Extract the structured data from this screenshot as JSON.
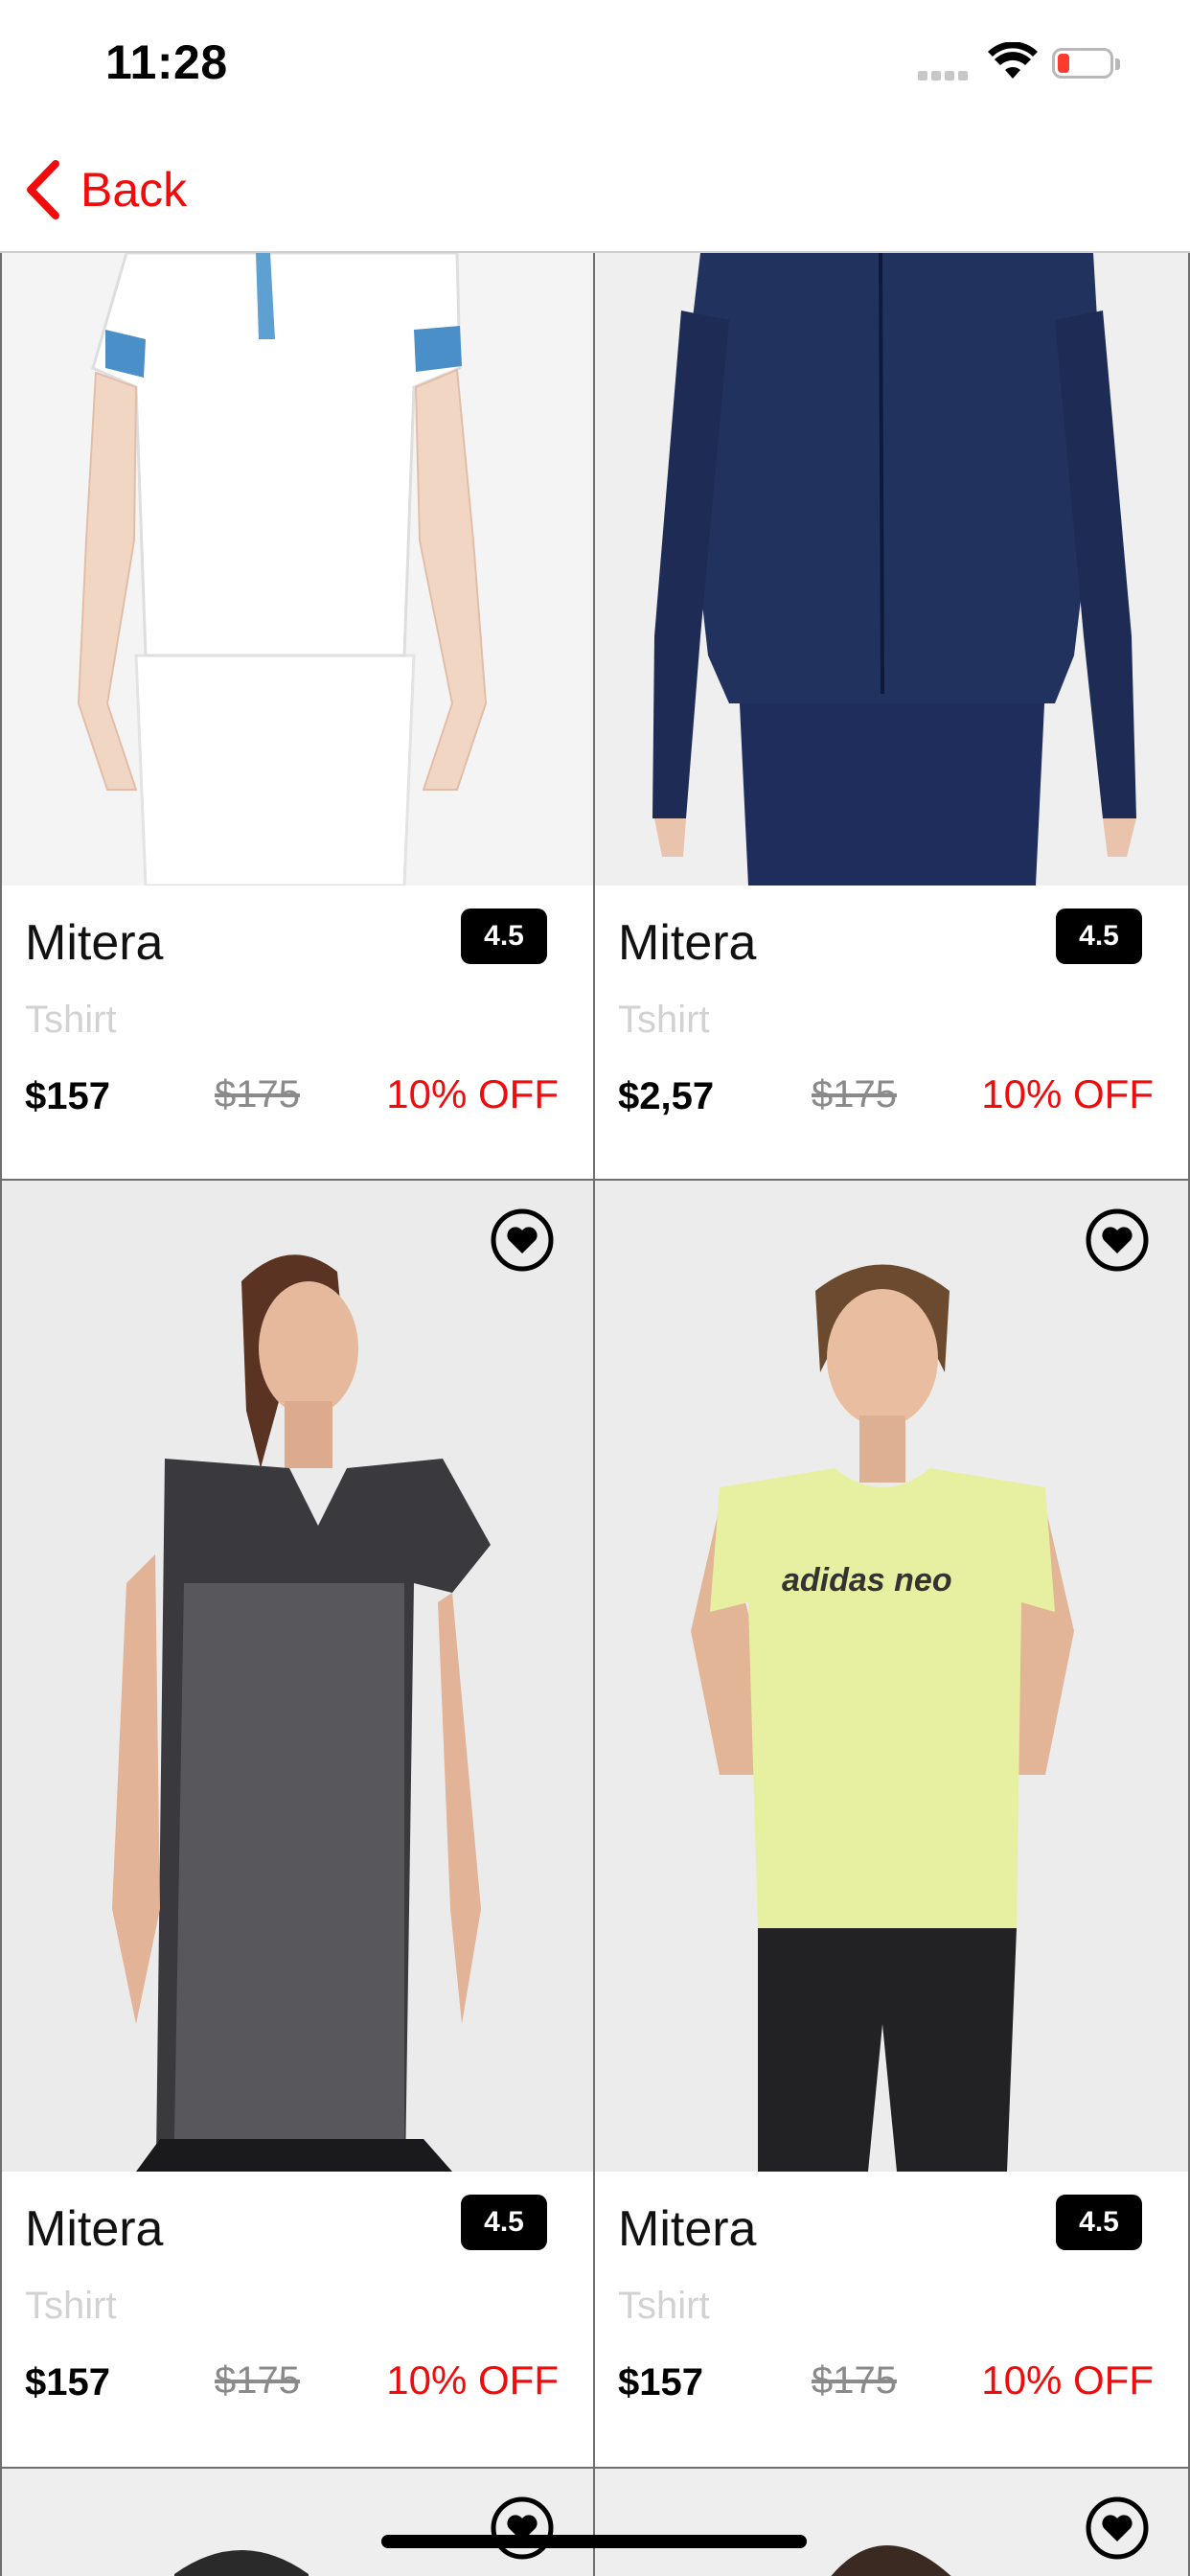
{
  "status_bar": {
    "time": "11:28",
    "icons": [
      "cellular-signal-icon",
      "wifi-icon",
      "battery-low-icon"
    ]
  },
  "nav": {
    "back_label": "Back",
    "back_icon": "chevron-left-icon",
    "accent_color": "#f10b0b"
  },
  "products": [
    {
      "title": "Mitera",
      "rating": "4.5",
      "category": "Tshirt",
      "price": "$157",
      "old_price": "$175",
      "discount": "10% OFF",
      "image": "white-polo-tshirt"
    },
    {
      "title": "Mitera",
      "rating": "4.5",
      "category": "Tshirt",
      "price": "$2,57",
      "old_price": "$175",
      "discount": "10% OFF",
      "image": "navy-track-jacket"
    },
    {
      "title": "Mitera",
      "rating": "4.5",
      "category": "Tshirt",
      "price": "$157",
      "old_price": "$175",
      "discount": "10% OFF",
      "image": "black-printed-tshirt",
      "favorite_icon": "heart-circle-icon"
    },
    {
      "title": "Mitera",
      "rating": "4.5",
      "category": "Tshirt",
      "price": "$157",
      "old_price": "$175",
      "discount": "10% OFF",
      "image": "yellow-adidas-neo-tshirt",
      "image_text": "adidas neo",
      "favorite_icon": "heart-circle-icon"
    }
  ],
  "colors": {
    "discount": "#f10b0b",
    "rating_badge": "#000000",
    "category": "#d2d2d2",
    "old_price": "#8a8a8a"
  }
}
